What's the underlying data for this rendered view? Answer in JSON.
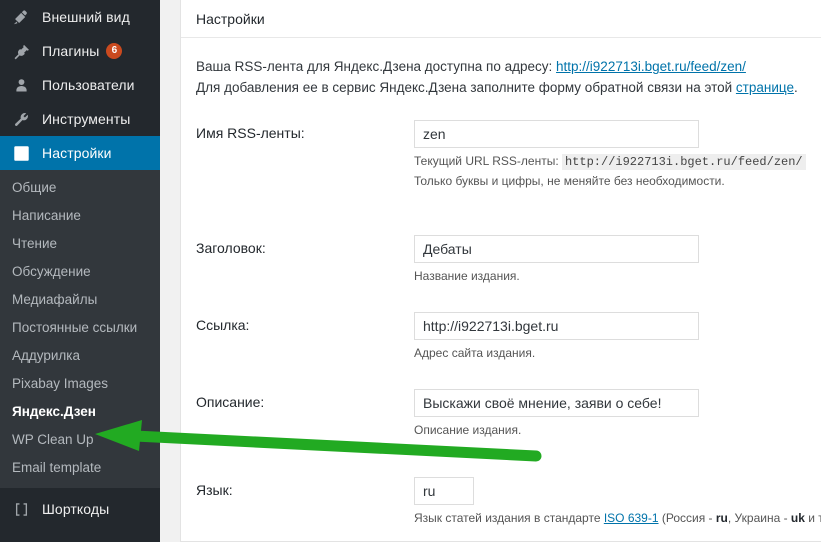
{
  "sidebar": {
    "top_items": [
      {
        "label": "Внешний вид",
        "icon": "appearance-paintbrush-icon",
        "badge": null
      },
      {
        "label": "Плагины",
        "icon": "plugins-plug-icon",
        "badge": "6"
      },
      {
        "label": "Пользователи",
        "icon": "users-person-icon",
        "badge": null
      },
      {
        "label": "Инструменты",
        "icon": "tools-wrench-icon",
        "badge": null
      }
    ],
    "current_item": {
      "label": "Настройки",
      "icon": "settings-sliders-icon"
    },
    "submenu_items": [
      {
        "label": "Общие",
        "active": false
      },
      {
        "label": "Написание",
        "active": false
      },
      {
        "label": "Чтение",
        "active": false
      },
      {
        "label": "Обсуждение",
        "active": false
      },
      {
        "label": "Медиафайлы",
        "active": false
      },
      {
        "label": "Постоянные ссылки",
        "active": false
      },
      {
        "label": "Аддурилка",
        "active": false
      },
      {
        "label": "Pixabay Images",
        "active": false
      },
      {
        "label": "Яндекс.Дзен",
        "active": true
      },
      {
        "label": "WP Clean Up",
        "active": false
      },
      {
        "label": "Email template",
        "active": false
      }
    ],
    "bottom_items": [
      {
        "label": "Шорткоды",
        "icon": "shortcodes-brackets-icon"
      }
    ]
  },
  "panel": {
    "title": "Настройки",
    "intro": {
      "line1_prefix": "Ваша RSS-лента для Яндекс.Дзена доступна по адресу: ",
      "line1_link": "http://i922713i.bget.ru/feed/zen/",
      "line2_prefix": "Для добавления ее в сервис Яндекс.Дзена заполните форму обратной связи на этой ",
      "line2_link": "странице",
      "line2_suffix": "."
    },
    "fields": [
      {
        "label": "Имя RSS-ленты:",
        "value": "zen",
        "placeholder": "",
        "hint1_prefix": "Текущий URL RSS-ленты: ",
        "hint1_code": "http://i922713i.bget.ru/feed/zen/",
        "hint2": "Только буквы и цифры, не меняйте без необходимости."
      },
      {
        "label": "Заголовок:",
        "value": "Дебаты",
        "placeholder": "",
        "hint1": "Название издания."
      },
      {
        "label": "Ссылка:",
        "value": "http://i922713i.bget.ru",
        "placeholder": "",
        "hint1": "Адрес сайта издания."
      },
      {
        "label": "Описание:",
        "value": "Выскажи своё мнение, заяви о себе!",
        "placeholder": "",
        "hint1": "Описание издания."
      },
      {
        "label": "Язык:",
        "value": "ru",
        "placeholder": "",
        "hint_lang_prefix": "Язык статей издания в стандарте ",
        "hint_lang_link": "ISO 639-1",
        "hint_lang_mid1": " (Россия - ",
        "hint_lang_code1": "ru",
        "hint_lang_mid2": ", Украина - ",
        "hint_lang_code2": "uk",
        "hint_lang_suffix": " и т.д.)"
      }
    ]
  },
  "annotation": {
    "arrow_color": "#22aa22",
    "arrow_name": "green-pointer-arrow"
  },
  "colors": {
    "sidebar_top_bg": "#23282d",
    "submenu_bg": "#32373c",
    "accent_blue": "#0073aa",
    "badge_orange": "#ca4a1f",
    "link_blue": "#0073aa"
  }
}
